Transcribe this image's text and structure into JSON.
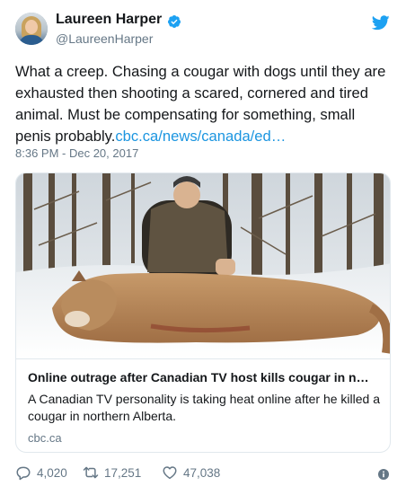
{
  "author": {
    "display_name": "Laureen Harper",
    "handle": "@LaureenHarper",
    "verified_icon": "verified-badge-icon",
    "avatar_icon": "avatar"
  },
  "brand_icon": "twitter-bird-icon",
  "tweet": {
    "text": "What a creep. Chasing a cougar with dogs until they are exhausted then shooting a scared, cornered and tired animal. Must be compensating for something, small penis probably.",
    "link": "cbc.ca/news/canada/ed…",
    "timestamp": "8:36 PM - Dec 20, 2017"
  },
  "card": {
    "title": "Online outrage after Canadian TV host kills cougar in n…",
    "description": "A Canadian TV personality is taking heat online after he killed a cougar in northern Alberta.",
    "domain": "cbc.ca"
  },
  "actions": {
    "replies": "4,020",
    "retweets": "17,251",
    "likes": "47,038"
  },
  "colors": {
    "link": "#1b95e0",
    "secondary_text": "#657786",
    "primary_text": "#14171a",
    "border": "#e1e8ed"
  }
}
